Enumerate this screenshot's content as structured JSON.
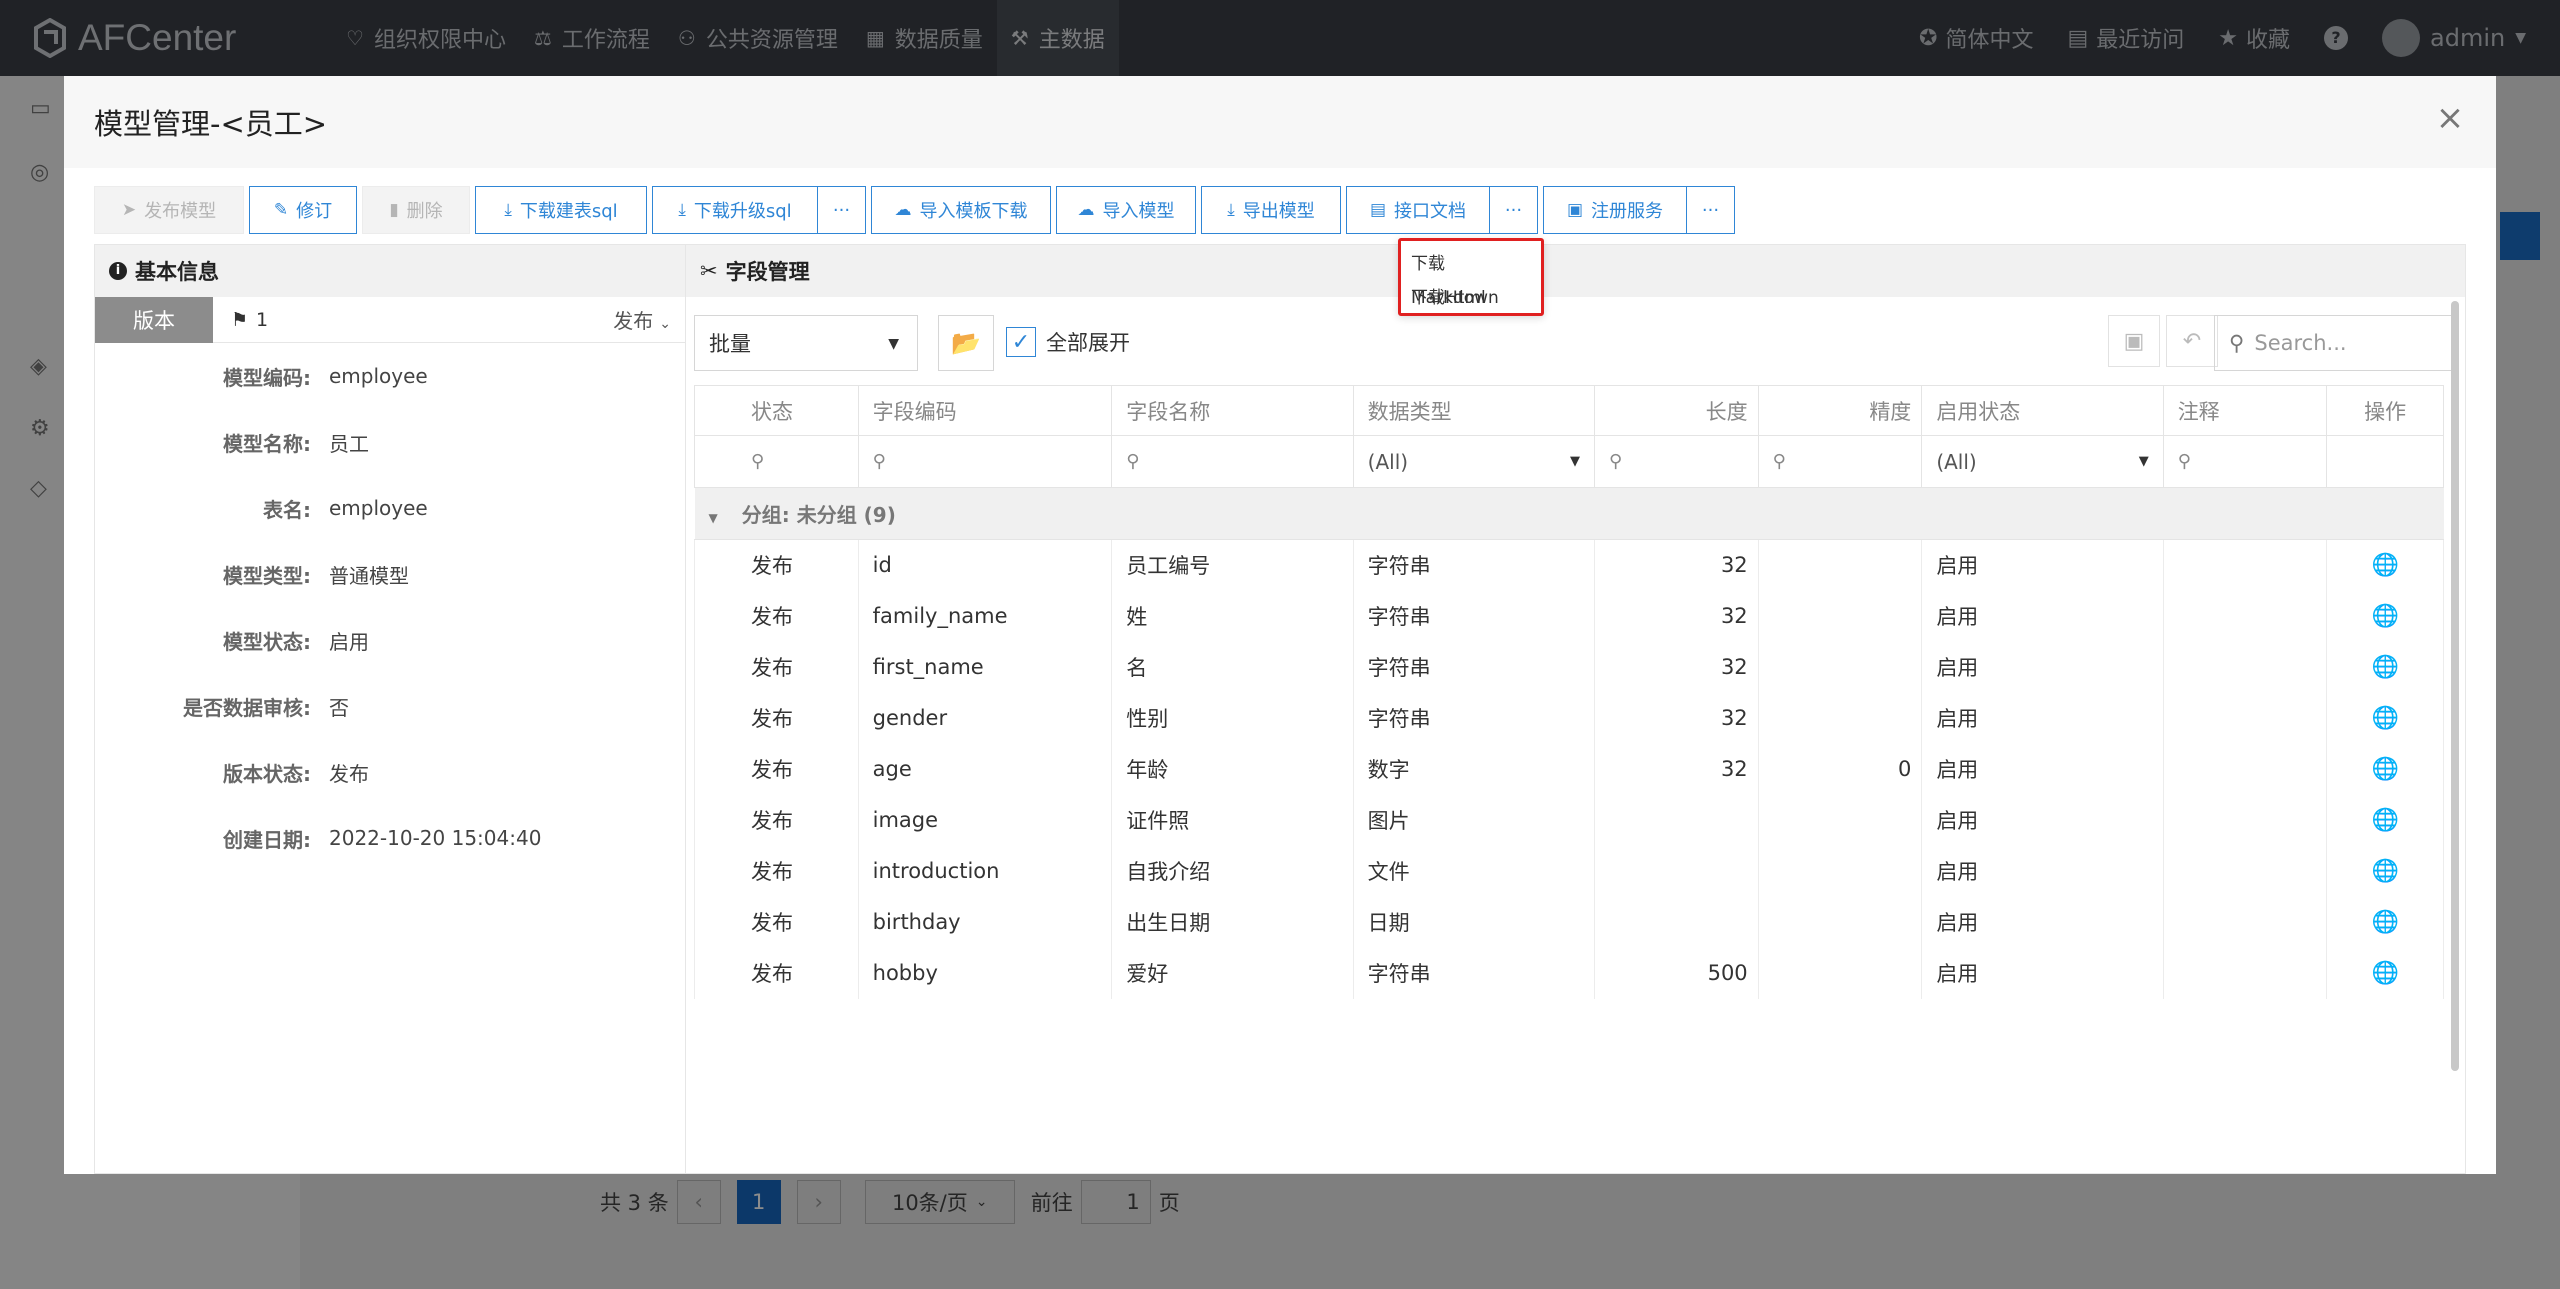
{
  "app": {
    "name": "AFCenter"
  },
  "nav": [
    {
      "icon": "heart-icon",
      "glyph": "♡",
      "label": "组织权限中心"
    },
    {
      "icon": "scale-icon",
      "glyph": "⚖",
      "label": "工作流程"
    },
    {
      "icon": "users-icon",
      "glyph": "⚇",
      "label": "公共资源管理"
    },
    {
      "icon": "chart-icon",
      "glyph": "▦",
      "label": "数据质量"
    },
    {
      "icon": "tools-icon",
      "glyph": "⚒",
      "label": "主数据"
    }
  ],
  "topright": {
    "lang": "简体中文",
    "recent": "最近访问",
    "favorite": "收藏",
    "help": "?",
    "user": "admin"
  },
  "modal": {
    "title": "模型管理-<员工>",
    "close": "×"
  },
  "toolbar": {
    "publish": "发布模型",
    "revise": "修订",
    "delete": "删除",
    "download_create_sql": "下载建表sql",
    "download_upgrade_sql": "下载升级sql",
    "more": "···",
    "import_template": "导入模板下载",
    "import_model": "导入模型",
    "export_model": "导出模型",
    "api_doc": "接口文档",
    "register_service": "注册服务"
  },
  "dropdown": {
    "markdown": "下载Markdown",
    "html": "下载Html"
  },
  "left": {
    "header": "基本信息",
    "version_tab": "版本",
    "version_num": "1",
    "version_state": "发布",
    "fields": [
      {
        "label": "模型编码:",
        "value": "employee"
      },
      {
        "label": "模型名称:",
        "value": "员工"
      },
      {
        "label": "表名:",
        "value": "employee"
      },
      {
        "label": "模型类型:",
        "value": "普通模型"
      },
      {
        "label": "模型状态:",
        "value": "启用"
      },
      {
        "label": "是否数据审核:",
        "value": "否"
      },
      {
        "label": "版本状态:",
        "value": "发布"
      },
      {
        "label": "创建日期:",
        "value": "2022-10-20 15:04:40"
      }
    ]
  },
  "right": {
    "header": "字段管理",
    "batch": "批量",
    "expand_all": "全部展开",
    "search_placeholder": "Search...",
    "columns": [
      "状态",
      "字段编码",
      "字段名称",
      "数据类型",
      "长度",
      "精度",
      "启用状态",
      "注释",
      "操作"
    ],
    "filter_all": "(All)",
    "group_label": "分组: 未分组 (9)",
    "rows": [
      {
        "status": "发布",
        "code": "id",
        "name": "员工编号",
        "type": "字符串",
        "length": "32",
        "precision": "",
        "enabled": "启用",
        "note": ""
      },
      {
        "status": "发布",
        "code": "family_name",
        "name": "姓",
        "type": "字符串",
        "length": "32",
        "precision": "",
        "enabled": "启用",
        "note": ""
      },
      {
        "status": "发布",
        "code": "first_name",
        "name": "名",
        "type": "字符串",
        "length": "32",
        "precision": "",
        "enabled": "启用",
        "note": ""
      },
      {
        "status": "发布",
        "code": "gender",
        "name": "性别",
        "type": "字符串",
        "length": "32",
        "precision": "",
        "enabled": "启用",
        "note": ""
      },
      {
        "status": "发布",
        "code": "age",
        "name": "年龄",
        "type": "数字",
        "length": "32",
        "precision": "0",
        "enabled": "启用",
        "note": ""
      },
      {
        "status": "发布",
        "code": "image",
        "name": "证件照",
        "type": "图片",
        "length": "",
        "precision": "",
        "enabled": "启用",
        "note": ""
      },
      {
        "status": "发布",
        "code": "introduction",
        "name": "自我介绍",
        "type": "文件",
        "length": "",
        "precision": "",
        "enabled": "启用",
        "note": ""
      },
      {
        "status": "发布",
        "code": "birthday",
        "name": "出生日期",
        "type": "日期",
        "length": "",
        "precision": "",
        "enabled": "启用",
        "note": ""
      },
      {
        "status": "发布",
        "code": "hobby",
        "name": "爱好",
        "type": "字符串",
        "length": "500",
        "precision": "",
        "enabled": "启用",
        "note": ""
      }
    ]
  },
  "bg_pager": {
    "total": "共 3 条",
    "current_page": "1",
    "page_size": "10条/页",
    "goto": "前往",
    "goto_value": "1",
    "page_unit": "页"
  },
  "colors": {
    "accent": "#2f86d6",
    "topbar": "#3b3f46",
    "highlight": "#e02020"
  }
}
